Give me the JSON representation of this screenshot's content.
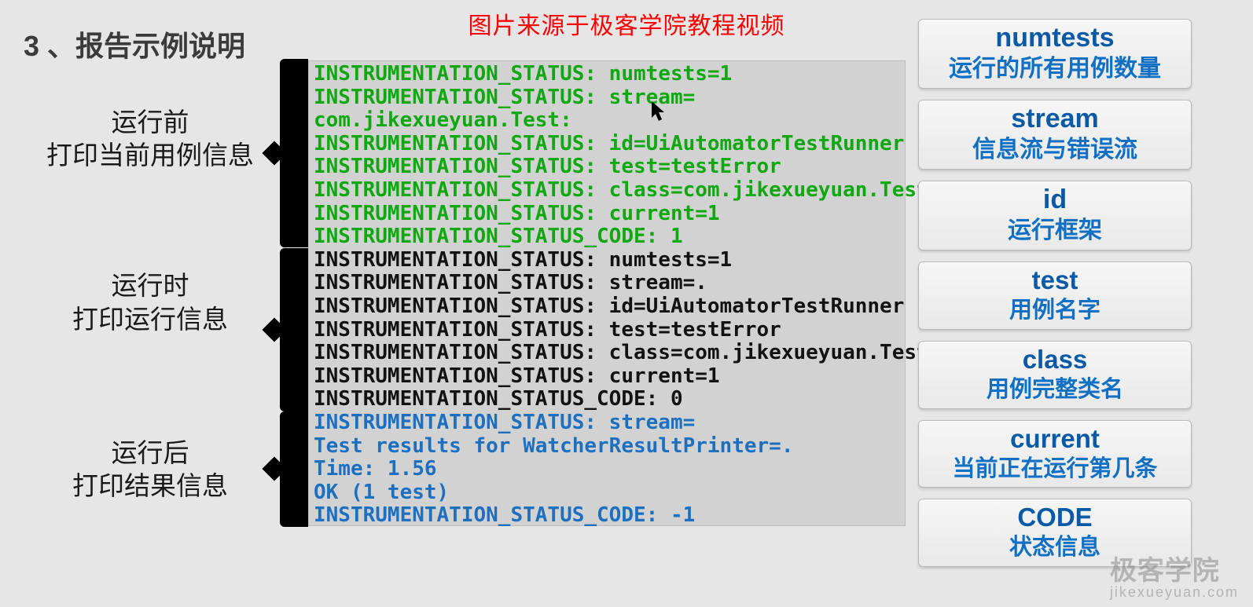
{
  "title": "3 、报告示例说明",
  "source_note": "图片来源于极客学院教程视频",
  "labels": {
    "pre": {
      "l1": "运行前",
      "l2": "打印当前用例信息"
    },
    "run": {
      "l1": "运行时",
      "l2": "打印运行信息"
    },
    "post": {
      "l1": "运行后",
      "l2": "打印结果信息"
    }
  },
  "terminal": {
    "green_lines": "INSTRUMENTATION_STATUS: numtests=1\nINSTRUMENTATION_STATUS: stream=\ncom.jikexueyuan.Test:\nINSTRUMENTATION_STATUS: id=UiAutomatorTestRunner\nINSTRUMENTATION_STATUS: test=testError\nINSTRUMENTATION_STATUS: class=com.jikexueyuan.Test\nINSTRUMENTATION_STATUS: current=1\nINSTRUMENTATION_STATUS_CODE: 1",
    "black_lines": "INSTRUMENTATION_STATUS: numtests=1\nINSTRUMENTATION_STATUS: stream=.\nINSTRUMENTATION_STATUS: id=UiAutomatorTestRunner\nINSTRUMENTATION_STATUS: test=testError\nINSTRUMENTATION_STATUS: class=com.jikexueyuan.Test\nINSTRUMENTATION_STATUS: current=1\nINSTRUMENTATION_STATUS_CODE: 0",
    "blue_lines": "INSTRUMENTATION_STATUS: stream=\nTest results for WatcherResultPrinter=.\nTime: 1.56\nOK (1 test)\nINSTRUMENTATION_STATUS_CODE: -1"
  },
  "cards": [
    {
      "h": "numtests",
      "s": "运行的所有用例数量"
    },
    {
      "h": "stream",
      "s": "信息流与错误流"
    },
    {
      "h": "id",
      "s": "运行框架"
    },
    {
      "h": "test",
      "s": "用例名字"
    },
    {
      "h": "class",
      "s": "用例完整类名"
    },
    {
      "h": "current",
      "s": "当前正在运行第几条"
    },
    {
      "h": "CODE",
      "s": "状态信息"
    }
  ],
  "watermark": {
    "main": "极客学院",
    "sub": "jikexueyuan.com"
  }
}
